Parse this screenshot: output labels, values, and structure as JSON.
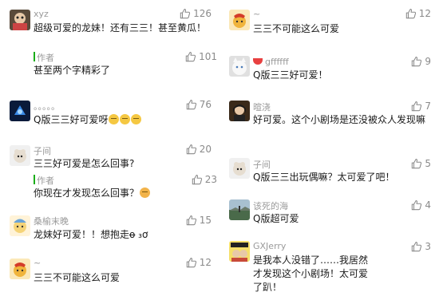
{
  "left": [
    {
      "name": "xyz",
      "likes": "126",
      "text": "超级可爱的龙妹！还有三三！甚至黄瓜！",
      "reply": {
        "name": "作者",
        "likes": "101",
        "text": "甚至两个字精彩了"
      }
    },
    {
      "name": "。。。。。",
      "likes": "76",
      "text": "Q版三三好可爱呀",
      "emoji_count": 3
    },
    {
      "name": "子间",
      "likes": "20",
      "text": "三三好可爱是怎么回事?",
      "reply": {
        "name": "作者",
        "likes": "23",
        "text": "你现在才发现怎么回事？"
      }
    },
    {
      "name": "桑榆末晚",
      "likes": "15",
      "text": "龙妹好可爱！！想抱走o̶ ₃ơ"
    },
    {
      "name": "~",
      "likes": "12",
      "text": "三三不可能这么可爱"
    }
  ],
  "right": [
    {
      "name": "~",
      "likes": "12",
      "text": "三三不可能这么可爱"
    },
    {
      "name": "gffffff",
      "likes": "9",
      "text": "Q版三三好可爱！"
    },
    {
      "name": "暄浇",
      "likes": "7",
      "text": "好可爱。这个小剧场是还没被众人发现嘛"
    },
    {
      "name": "子间",
      "likes": "5",
      "text": "Q版三三出玩偶嘛？太可爱了吧！"
    },
    {
      "name": "该死的海",
      "likes": "4",
      "text": "Q版超可爱"
    },
    {
      "name": "GXJerry",
      "likes": "3",
      "text": "是我本人没错了……我居然才发现这个小剧场！太可爱了趴！"
    }
  ],
  "icons": {
    "like": "thumbs-up-icon"
  },
  "colors": {
    "author_bar": "#1aad19",
    "meta_text": "#9a9a9a"
  }
}
